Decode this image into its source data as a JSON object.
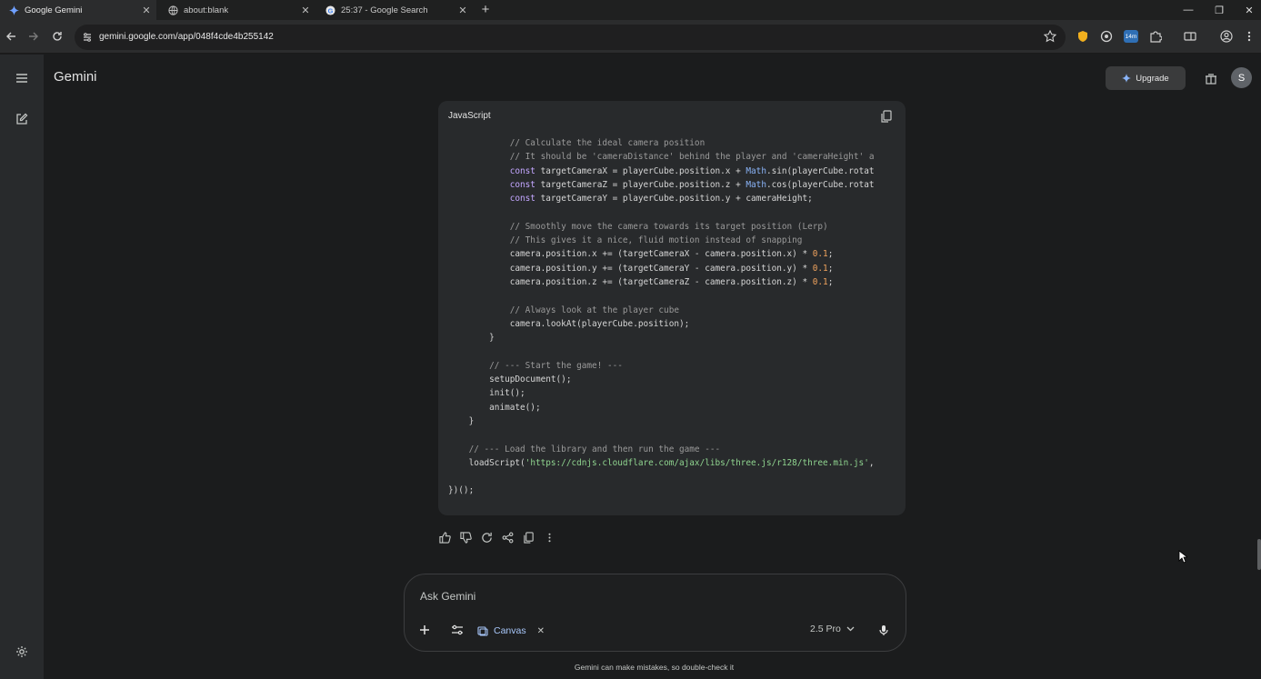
{
  "browser": {
    "tabs": [
      {
        "title": "Google Gemini",
        "icon": "gemini-sparkle-icon",
        "active": true
      },
      {
        "title": "about:blank",
        "icon": "globe-icon",
        "active": false
      },
      {
        "title": "25:37 - Google Search",
        "icon": "google-g-icon",
        "active": false
      }
    ],
    "url": "gemini.google.com/app/048f4cde4b255142",
    "extension_badge": "14m"
  },
  "app": {
    "brand": "Gemini",
    "upgrade_label": "Upgrade",
    "avatar_initial": "S"
  },
  "code_block": {
    "language": "JavaScript",
    "lines": [
      {
        "indent": 12,
        "tokens": [
          {
            "t": "// Calculate the ideal camera position",
            "c": "cm"
          }
        ]
      },
      {
        "indent": 12,
        "tokens": [
          {
            "t": "// It should be 'cameraDistance' behind the player and 'cameraHeight' a",
            "c": "cm"
          }
        ]
      },
      {
        "indent": 12,
        "tokens": [
          {
            "t": "const",
            "c": "kw"
          },
          {
            "t": " targetCameraX = playerCube.position.x + ",
            "c": ""
          },
          {
            "t": "Math",
            "c": "fn"
          },
          {
            "t": ".sin(playerCube.rotat",
            "c": ""
          }
        ]
      },
      {
        "indent": 12,
        "tokens": [
          {
            "t": "const",
            "c": "kw"
          },
          {
            "t": " targetCameraZ = playerCube.position.z + ",
            "c": ""
          },
          {
            "t": "Math",
            "c": "fn"
          },
          {
            "t": ".cos(playerCube.rotat",
            "c": ""
          }
        ]
      },
      {
        "indent": 12,
        "tokens": [
          {
            "t": "const",
            "c": "kw"
          },
          {
            "t": " targetCameraY = playerCube.position.y + cameraHeight;",
            "c": ""
          }
        ]
      },
      {
        "indent": 0,
        "tokens": []
      },
      {
        "indent": 12,
        "tokens": [
          {
            "t": "// Smoothly move the camera towards its target position (Lerp)",
            "c": "cm"
          }
        ]
      },
      {
        "indent": 12,
        "tokens": [
          {
            "t": "// This gives it a nice, fluid motion instead of snapping",
            "c": "cm"
          }
        ]
      },
      {
        "indent": 12,
        "tokens": [
          {
            "t": "camera.position.x += (targetCameraX - camera.position.x) * ",
            "c": ""
          },
          {
            "t": "0.1",
            "c": "num"
          },
          {
            "t": ";",
            "c": ""
          }
        ]
      },
      {
        "indent": 12,
        "tokens": [
          {
            "t": "camera.position.y += (targetCameraY - camera.position.y) * ",
            "c": ""
          },
          {
            "t": "0.1",
            "c": "num"
          },
          {
            "t": ";",
            "c": ""
          }
        ]
      },
      {
        "indent": 12,
        "tokens": [
          {
            "t": "camera.position.z += (targetCameraZ - camera.position.z) * ",
            "c": ""
          },
          {
            "t": "0.1",
            "c": "num"
          },
          {
            "t": ";",
            "c": ""
          }
        ]
      },
      {
        "indent": 0,
        "tokens": []
      },
      {
        "indent": 12,
        "tokens": [
          {
            "t": "// Always look at the player cube",
            "c": "cm"
          }
        ]
      },
      {
        "indent": 12,
        "tokens": [
          {
            "t": "camera.lookAt(playerCube.position);",
            "c": ""
          }
        ]
      },
      {
        "indent": 8,
        "tokens": [
          {
            "t": "}",
            "c": ""
          }
        ]
      },
      {
        "indent": 0,
        "tokens": []
      },
      {
        "indent": 8,
        "tokens": [
          {
            "t": "// --- Start the game! ---",
            "c": "cm"
          }
        ]
      },
      {
        "indent": 8,
        "tokens": [
          {
            "t": "setupDocument();",
            "c": ""
          }
        ]
      },
      {
        "indent": 8,
        "tokens": [
          {
            "t": "init();",
            "c": ""
          }
        ]
      },
      {
        "indent": 8,
        "tokens": [
          {
            "t": "animate();",
            "c": ""
          }
        ]
      },
      {
        "indent": 4,
        "tokens": [
          {
            "t": "}",
            "c": ""
          }
        ]
      },
      {
        "indent": 0,
        "tokens": []
      },
      {
        "indent": 4,
        "tokens": [
          {
            "t": "// --- Load the library and then run the game ---",
            "c": "cm"
          }
        ]
      },
      {
        "indent": 4,
        "tokens": [
          {
            "t": "loadScript(",
            "c": ""
          },
          {
            "t": "'https://cdnjs.cloudflare.com/ajax/libs/three.js/r128/three.min.js'",
            "c": "str"
          },
          {
            "t": ",",
            "c": ""
          }
        ]
      },
      {
        "indent": 0,
        "tokens": []
      },
      {
        "indent": 0,
        "tokens": [
          {
            "t": "})();",
            "c": ""
          }
        ]
      }
    ]
  },
  "input": {
    "placeholder": "Ask Gemini",
    "canvas_label": "Canvas",
    "model_label": "2.5 Pro"
  },
  "disclaimer": "Gemini can make mistakes, so double-check it",
  "colors": {
    "background": "#1b1c1d",
    "sidebar": "#282a2c",
    "code_bg": "#282a2c",
    "accent": "#a8c7fa"
  }
}
